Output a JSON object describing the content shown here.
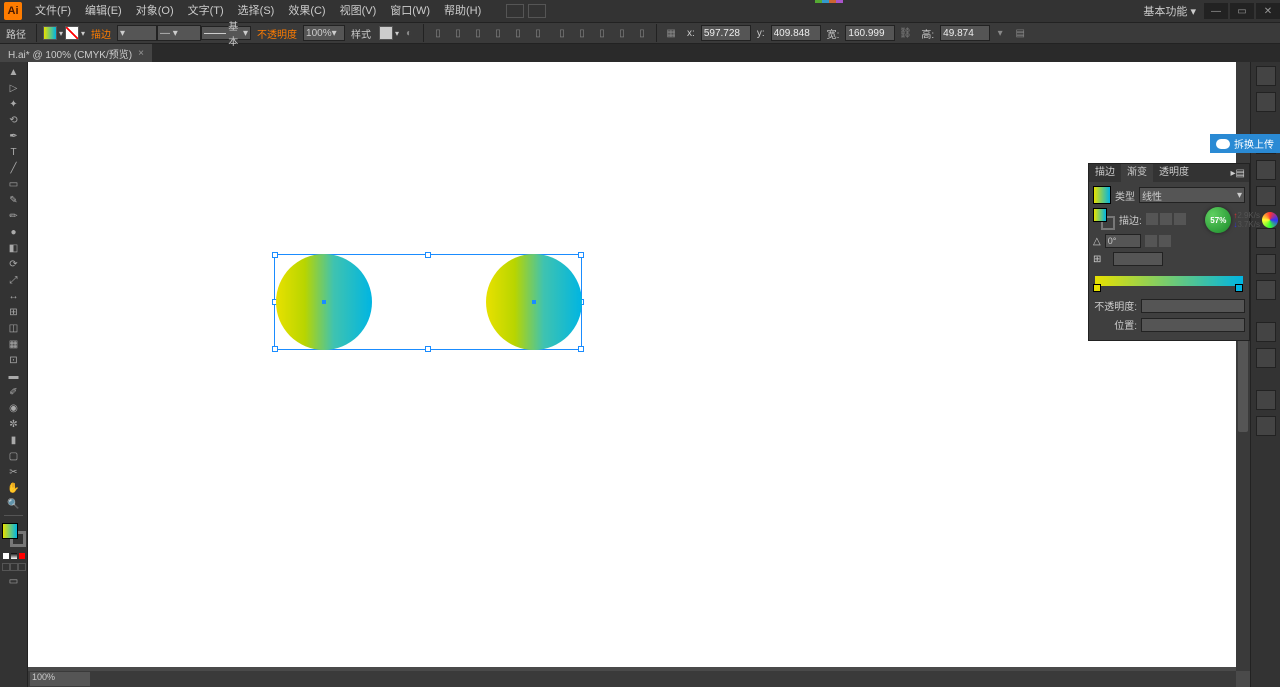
{
  "logo": "Ai",
  "menu": {
    "file": "文件(F)",
    "edit": "编辑(E)",
    "object": "对象(O)",
    "type": "文字(T)",
    "select": "选择(S)",
    "effect": "效果(C)",
    "view": "视图(V)",
    "window": "窗口(W)",
    "help": "帮助(H)"
  },
  "workspace_label": "基本功能",
  "control": {
    "mode_label": "路径",
    "stroke_label": "描边",
    "stroke_dropdown": "基本",
    "opacity_label": "不透明度",
    "opacity_value": "100%",
    "style_label": "样式",
    "x_label": "x:",
    "x_value": "597.728",
    "y_label": "y:",
    "y_value": "409.848",
    "w_label": "宽:",
    "w_value": "160.999",
    "h_label": "高:",
    "h_value": "49.874"
  },
  "doctab": {
    "name": "H.ai* @ 100% (CMYK/预览)",
    "close": "×"
  },
  "panel": {
    "tab_stroke": "描边",
    "tab_gradient": "渐变",
    "tab_transparency": "透明度",
    "type_label": "类型",
    "type_value": "线性",
    "stroke_label": "描边:",
    "angle_value": "0°",
    "opacity_label": "不透明度:",
    "position_label": "位置:"
  },
  "net": {
    "pct": "57%",
    "up": "2.9K/s",
    "down": "3.7K/s"
  },
  "side_tag": "拆换上传",
  "scroll": {
    "zoom": "100%"
  }
}
